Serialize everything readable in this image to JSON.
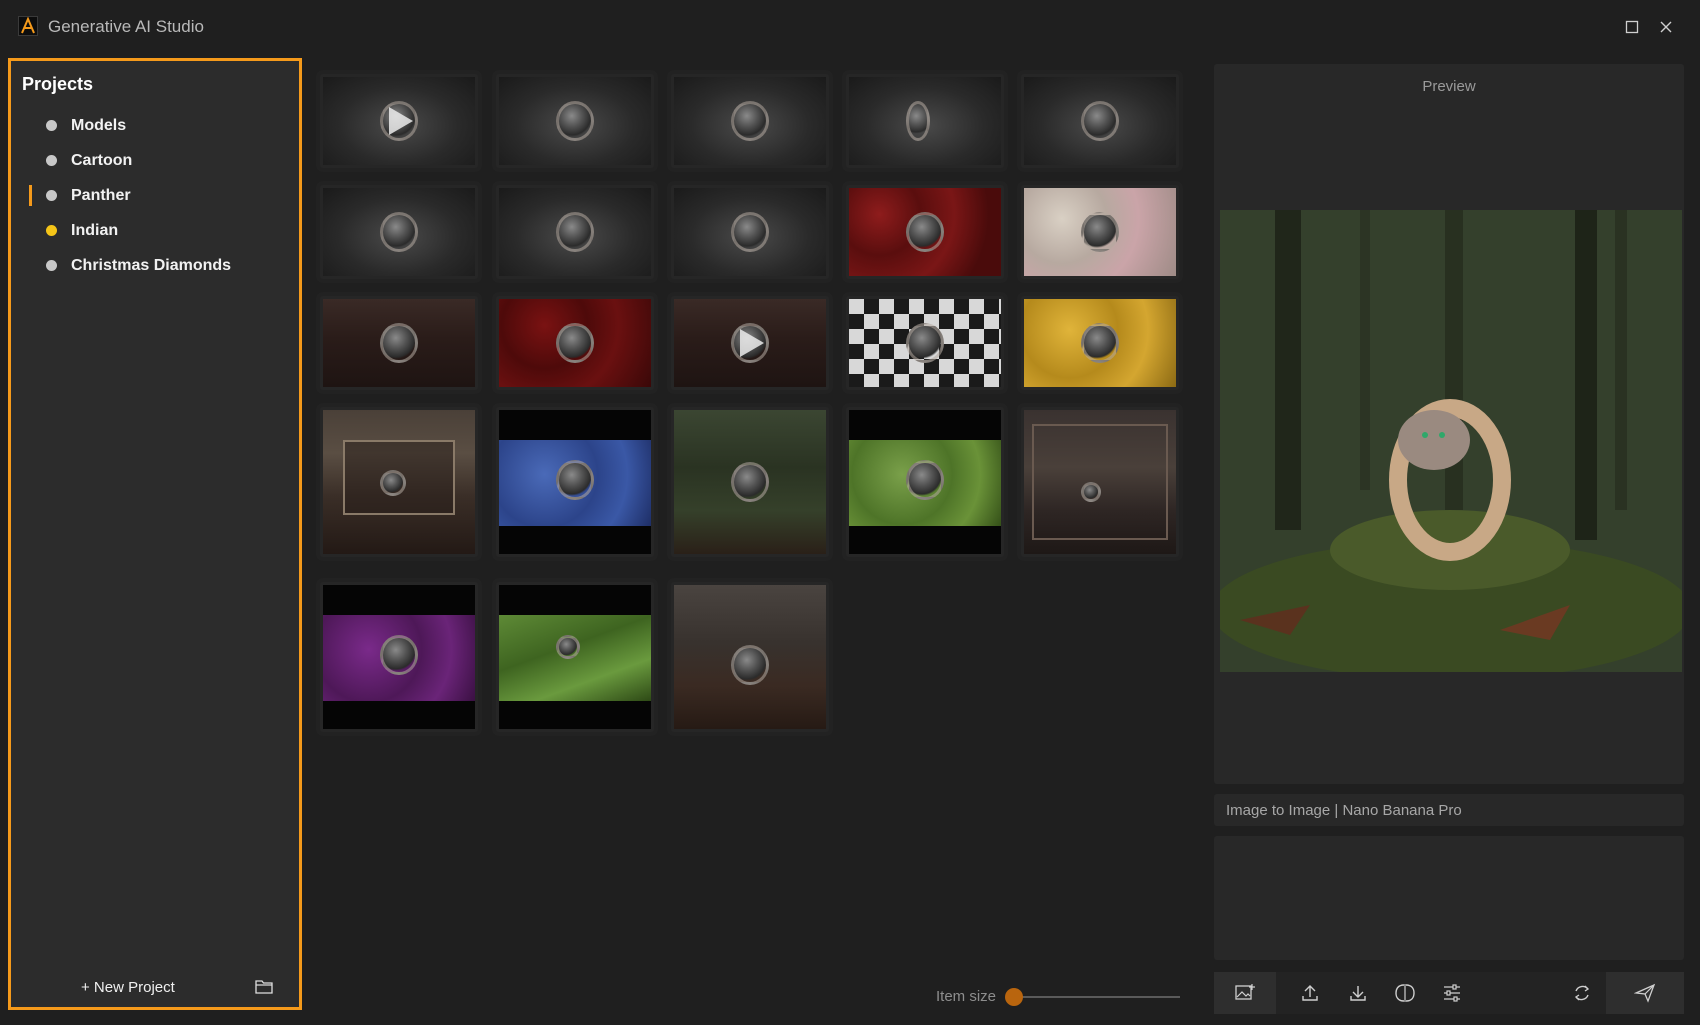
{
  "window": {
    "title": "Generative AI Studio",
    "maximize_icon": "maximize-icon",
    "close_icon": "close-icon"
  },
  "sidebar": {
    "title": "Projects",
    "items": [
      {
        "label": "Models",
        "dot_color": "#c8c8c8",
        "active": false
      },
      {
        "label": "Cartoon",
        "dot_color": "#c8c8c8",
        "active": false
      },
      {
        "label": "Panther",
        "dot_color": "#c8c8c8",
        "active": true
      },
      {
        "label": "Indian",
        "dot_color": "#f5c518",
        "active": false
      },
      {
        "label": "Christmas Diamonds",
        "dot_color": "#c8c8c8",
        "active": false
      }
    ],
    "new_project_label": "+ New Project",
    "accent_color": "#f59a1b"
  },
  "gallery": {
    "item_size_label": "Item size",
    "item_size_value": 0.0
  },
  "preview": {
    "label": "Preview"
  },
  "model_bar": {
    "text": "Image to Image | Nano Banana Pro"
  },
  "prompt": {
    "value": "",
    "placeholder": ""
  },
  "toolbar": {
    "icons": [
      "add-image-icon",
      "upload-icon",
      "download-icon",
      "compare-icon",
      "settings-sliders-icon",
      "refresh-icon",
      "send-icon"
    ]
  }
}
